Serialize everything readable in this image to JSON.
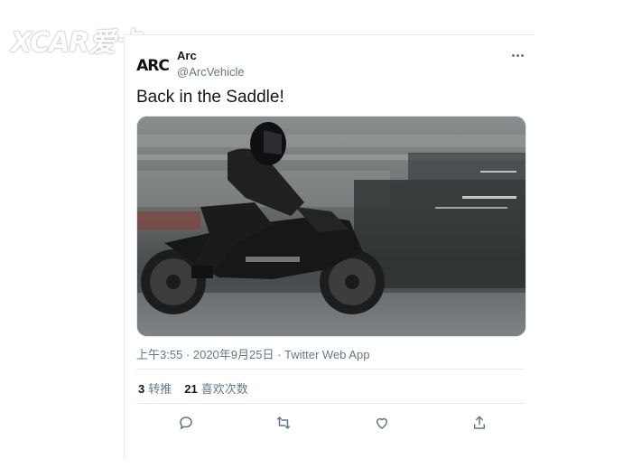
{
  "watermark": {
    "text": "XCAR爱卡"
  },
  "tweet": {
    "avatar_text": "ARC",
    "display_name": "Arc",
    "handle": "@ArcVehicle",
    "text": "Back in the Saddle!",
    "timestamp": "上午3:55 · 2020年9月25日 · Twitter Web App",
    "retweets": {
      "count": "3",
      "label": "转推"
    },
    "likes": {
      "count": "21",
      "label": "喜欢次数"
    }
  },
  "icons": {
    "more": "more-icon",
    "reply": "reply-icon",
    "retweet": "retweet-icon",
    "like": "like-icon",
    "share": "share-icon"
  },
  "colors": {
    "text_primary": "#14171a",
    "text_secondary": "#657786",
    "divider": "#e6ecf0"
  }
}
